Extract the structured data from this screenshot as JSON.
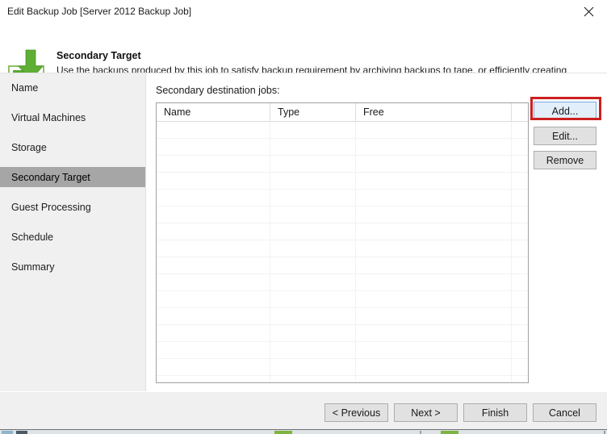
{
  "window": {
    "title": "Edit Backup Job [Server 2012 Backup Job]",
    "close_icon": "close-icon"
  },
  "header": {
    "icon": "vm-download-arrow-icon",
    "title": "Secondary Target",
    "description": "Use the backups produced by this job to satisfy backup requirement by archiving backups to tape, or efficiently creating remote backups and replicas over WAN."
  },
  "sidebar": {
    "items": [
      {
        "label": "Name",
        "selected": false
      },
      {
        "label": "Virtual Machines",
        "selected": false
      },
      {
        "label": "Storage",
        "selected": false
      },
      {
        "label": "Secondary Target",
        "selected": true
      },
      {
        "label": "Guest Processing",
        "selected": false
      },
      {
        "label": "Schedule",
        "selected": false
      },
      {
        "label": "Summary",
        "selected": false
      }
    ],
    "selected_bg": "#a6a6a6",
    "bg": "#f0f0f0"
  },
  "main": {
    "list_label": "Secondary destination jobs:",
    "table": {
      "columns": [
        {
          "header": "Name",
          "width": 141
        },
        {
          "header": "Type",
          "width": 106
        },
        {
          "header": "Free",
          "width": 193
        },
        {
          "header": "",
          "width": 20
        }
      ],
      "rows": [],
      "empty_row_count": 15
    },
    "buttons": [
      {
        "label": "Add...",
        "focused": true,
        "highlighted": true
      },
      {
        "label": "Edit...",
        "focused": false,
        "highlighted": false
      },
      {
        "label": "Remove",
        "focused": false,
        "highlighted": false
      }
    ],
    "highlight_color": "#cc2020"
  },
  "footer": {
    "buttons": [
      {
        "label": "< Previous"
      },
      {
        "label": "Next >"
      },
      {
        "label": "Finish"
      },
      {
        "label": "Cancel"
      }
    ]
  }
}
